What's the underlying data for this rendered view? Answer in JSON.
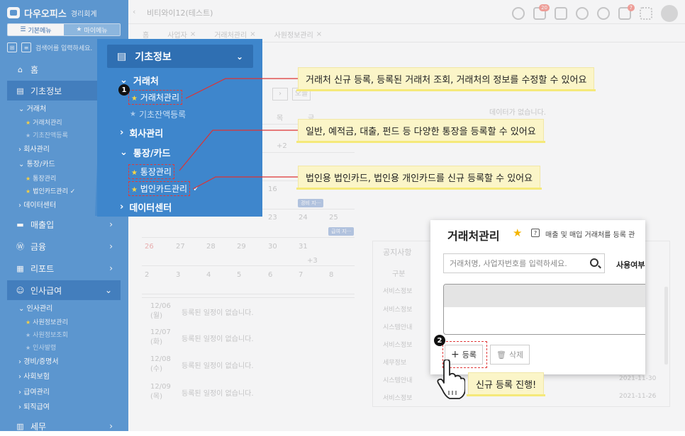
{
  "app": {
    "title": "다우오피스",
    "subtitle": "경리회계"
  },
  "sidebar": {
    "menu_tabs": [
      "기본메뉴",
      "마이메뉴"
    ],
    "search_placeholder": "검색어를 입력하세요.",
    "items": [
      {
        "label": "홈"
      },
      {
        "label": "기초정보"
      },
      {
        "label": "매출입"
      },
      {
        "label": "금융"
      },
      {
        "label": "리포트"
      },
      {
        "label": "인사급여"
      },
      {
        "label": "세무"
      }
    ],
    "basic_sub": [
      {
        "label": "거래처"
      },
      {
        "label": "회사관리"
      },
      {
        "label": "통장/카드"
      },
      {
        "label": "데이터센터"
      }
    ],
    "basic_leaves": [
      {
        "label": "거래처관리"
      },
      {
        "label": "기초잔액등록"
      },
      {
        "label": "통장관리"
      },
      {
        "label": "법인카드관리"
      }
    ],
    "hr_sub": [
      {
        "label": "인사관리"
      },
      {
        "label": "경비/증명서"
      },
      {
        "label": "사회보험"
      },
      {
        "label": "급여관리"
      },
      {
        "label": "퇴직급여"
      }
    ],
    "hr_leaves": [
      {
        "label": "사원정보관리"
      },
      {
        "label": "사원정보조회"
      },
      {
        "label": "인사발령"
      }
    ]
  },
  "topbar": {
    "company": "비티와이12(테스트)",
    "badge_notice": "20",
    "badge_alarm": "7"
  },
  "tabs": [
    "홈",
    "사업자",
    "거래처관리",
    "사원정보관리"
  ],
  "background": {
    "today_btn": "오늘",
    "weekdays": [
      "목",
      "금"
    ],
    "cal_numbers": [
      "+2",
      "16",
      "23",
      "24",
      "25",
      "26",
      "27",
      "28",
      "29",
      "30",
      "31",
      "+3",
      "2",
      "3",
      "4",
      "5",
      "6",
      "7",
      "8"
    ],
    "no_data": "데이터가 없습니다.",
    "events": [
      "경비 지···",
      "급여 지···"
    ],
    "agenda": [
      {
        "date": "12/06",
        "day": "(월)"
      },
      {
        "date": "12/07",
        "day": "(화)"
      },
      {
        "date": "12/08",
        "day": "(수)"
      },
      {
        "date": "12/09",
        "day": "(목)"
      }
    ],
    "no_schedule": "등록된 일정이 없습니다.",
    "notice_title": "공지사항",
    "notice_col": "구분",
    "notice_types": [
      "서비스정보",
      "서비스정보",
      "시스템안내",
      "서비스정보",
      "세무정보",
      "시스템안내",
      "서비스정보"
    ],
    "notice_dates": [
      "2021-11-30",
      "2021-11-26"
    ]
  },
  "popup": {
    "title": "기초정보",
    "groups": [
      {
        "label": "거래처"
      },
      {
        "label": "회사관리"
      },
      {
        "label": "통장/카드"
      },
      {
        "label": "데이터센터"
      }
    ],
    "leaves": [
      {
        "label": "거래처관리"
      },
      {
        "label": "기초잔액등록"
      },
      {
        "label": "통장관리"
      },
      {
        "label": "법인카드관리"
      }
    ]
  },
  "callouts": [
    "거래처 신규 등록, 등록된 거래처 조회, 거래처의 정보를 수정할 수 있어요",
    "일반, 예적금, 대출, 펀드 등 다양한 통장을 등록할 수 있어요",
    "법인용 법인카드, 법인용 개인카드를 신규 등록할 수 있어요",
    "신규 등록 진행!"
  ],
  "steps": [
    "1",
    "2"
  ],
  "zoom": {
    "title": "거래처관리",
    "help": "?",
    "description": "매출 및 매입 거래처를 등록 관",
    "search_placeholder": "거래처명, 사업자번호를 입력하세요.",
    "usage_label": "사용여부",
    "add_button": "등록",
    "delete_button": "삭제"
  },
  "colors": {
    "sidebar": "#5b9ad6",
    "popup": "#3e86cc",
    "highlight": "#e03a3a",
    "callout": "#fbf5c8"
  }
}
